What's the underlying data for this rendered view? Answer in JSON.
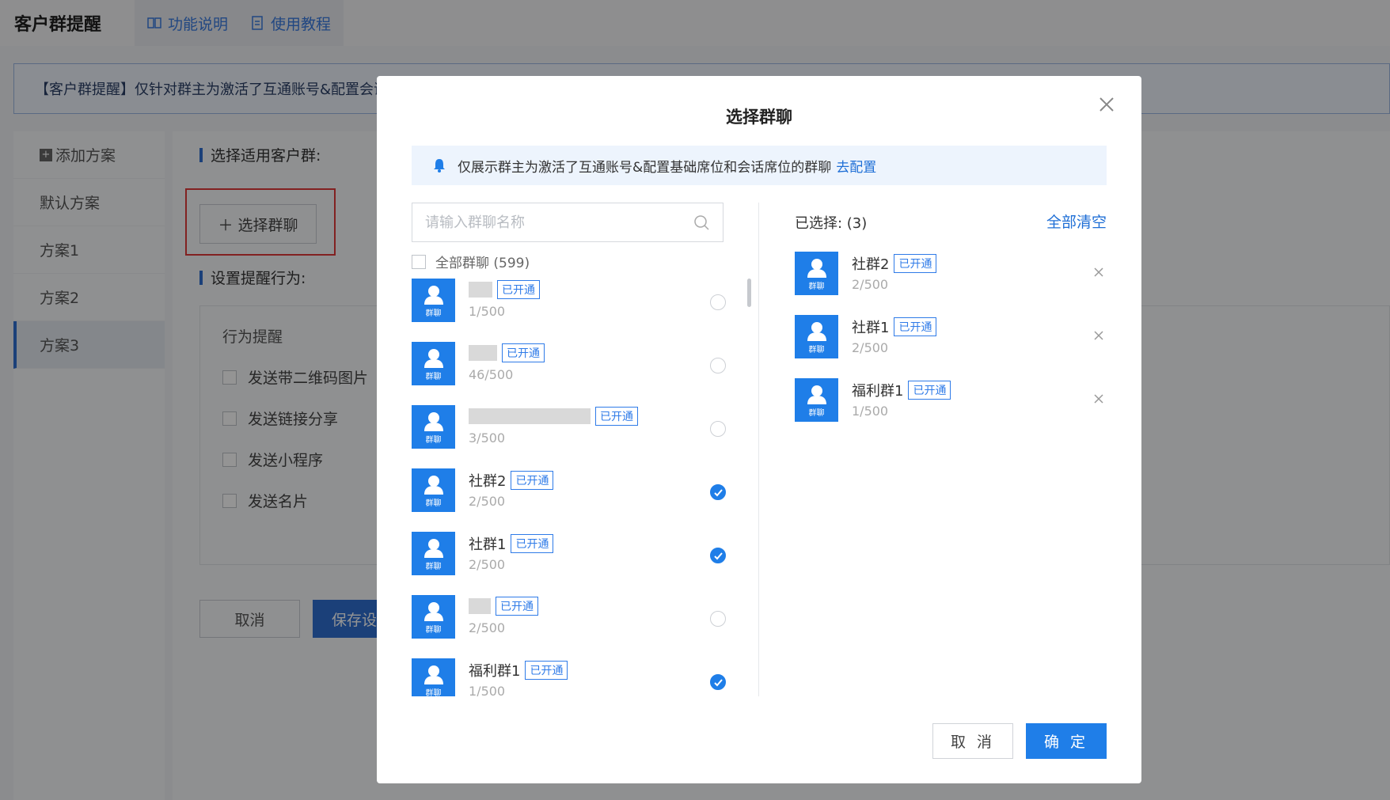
{
  "app": {
    "title": "客户群提醒",
    "nav": [
      "功能说明",
      "使用教程"
    ]
  },
  "banner": "【客户群提醒】仅针对群主为激活了互通账号&配置会话",
  "sidebar": {
    "add_label": "添加方案",
    "items": [
      "默认方案",
      "方案1",
      "方案2",
      "方案3"
    ],
    "active": "方案3"
  },
  "main": {
    "section1": "选择适用客户群:",
    "select_btn": "选择群聊",
    "section2": "设置提醒行为:",
    "behavior_label": "行为提醒",
    "options": [
      "发送带二维码图片",
      "发送链接分享",
      "发送小程序",
      "发送名片"
    ],
    "cancel": "取消",
    "save": "保存设"
  },
  "modal": {
    "title": "选择群聊",
    "tip": "仅展示群主为激活了互通账号&配置基础席位和会话席位的群聊",
    "tip_link": "去配置",
    "search_placeholder": "请输入群聊名称",
    "select_all": "全部群聊 (599)",
    "avatar_caption": "群聊",
    "badge": "已开通",
    "groups": [
      {
        "name": "",
        "count": "1/500",
        "checked": false
      },
      {
        "name": "",
        "count": "46/500",
        "checked": false
      },
      {
        "name": "",
        "count": "3/500",
        "checked": false
      },
      {
        "name": "社群2",
        "count": "2/500",
        "checked": true
      },
      {
        "name": "社群1",
        "count": "2/500",
        "checked": true
      },
      {
        "name": "",
        "count": "2/500",
        "checked": false
      },
      {
        "name": "福利群1",
        "count": "1/500",
        "checked": true
      }
    ],
    "selected_label": "已选择: (3)",
    "clear_all": "全部清空",
    "selected": [
      {
        "name": "社群2",
        "count": "2/500"
      },
      {
        "name": "社群1",
        "count": "2/500"
      },
      {
        "name": "福利群1",
        "count": "1/500"
      }
    ],
    "cancel": "取 消",
    "ok": "确 定"
  },
  "colors": {
    "primary": "#1f7ee8",
    "link": "#1f6fd6",
    "highlight": "#e03a3a"
  }
}
